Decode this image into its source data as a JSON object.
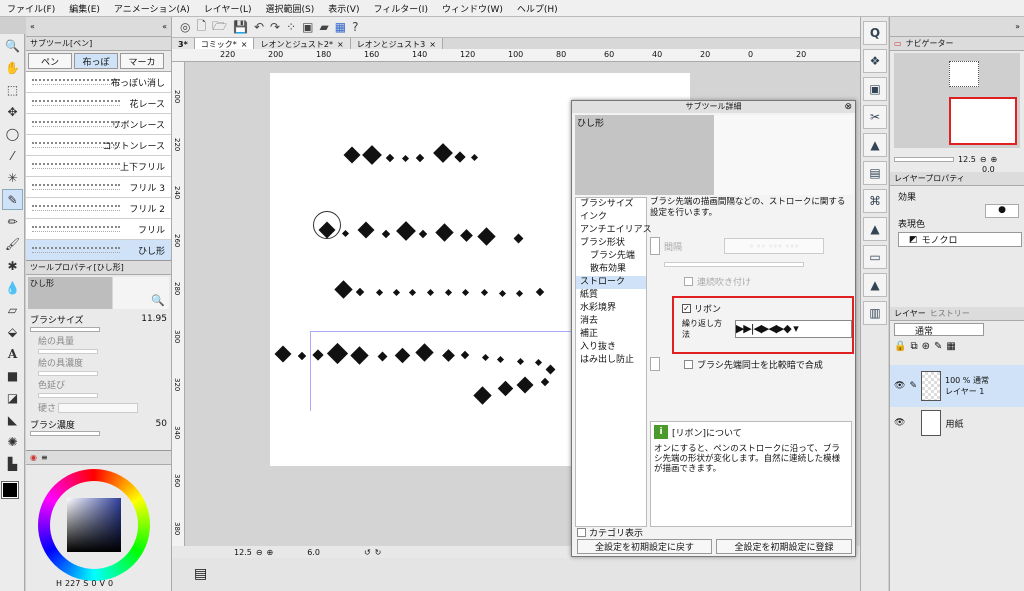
{
  "menu": [
    "ファイル(F)",
    "編集(E)",
    "アニメーション(A)",
    "レイヤー(L)",
    "選択範囲(S)",
    "表示(V)",
    "フィルター(I)",
    "ウィンドウ(W)",
    "ヘルプ(H)"
  ],
  "subtool": {
    "title": "サブツール[ペン]",
    "tabs": [
      "ペン",
      "布っぽ",
      "マーカ"
    ],
    "brushes": [
      "布っぽい消し",
      "花レース",
      "リボンレース",
      "コットンレース",
      "上下フリル",
      "フリル 3",
      "フリル 2",
      "フリル",
      "ひし形"
    ],
    "selected": "ひし形"
  },
  "toolprop": {
    "title": "ツールプロパティ[ひし形]",
    "preview_label": "ひし形",
    "brush_size_label": "ブラシサイズ",
    "brush_size": "11.95",
    "paint_amount": "絵の具量",
    "paint_density": "絵の具濃度",
    "color_stretch": "色延び",
    "hardness": "硬さ",
    "brush_density_label": "ブラシ濃度",
    "brush_density": "50"
  },
  "color": {
    "h": "227",
    "s": "0",
    "v": "0"
  },
  "doc_tabs": [
    "3*",
    "コミック*",
    "レオンとジュスト2*",
    "レオンとジュスト3"
  ],
  "ruler_h": [
    "220",
    "200",
    "180",
    "160",
    "140",
    "120",
    "100",
    "80",
    "60",
    "40",
    "20",
    "0",
    "20"
  ],
  "ruler_v": [
    "200",
    "220",
    "240",
    "260",
    "280",
    "300",
    "320",
    "340",
    "360",
    "380"
  ],
  "status": {
    "zoom": "12.5",
    "angle": "6.0"
  },
  "dialog": {
    "title": "サブツール詳細",
    "preview_label": "ひし形",
    "categories": [
      "ブラシサイズ",
      "インク",
      "アンチエイリアス",
      "ブラシ形状",
      "ブラシ先端",
      "散布効果",
      "ストローク",
      "紙質",
      "水彩境界",
      "消去",
      "補正",
      "入り抜き",
      "はみ出し防止"
    ],
    "indented": [
      4,
      5
    ],
    "selected": "ストローク",
    "description": "ブラシ先端の描画間隔などの、ストロークに関する設定を行います。",
    "spacing_label": "間隔",
    "continuous_label": "連続吹き付け",
    "ribbon_label": "リボン",
    "repeat_label": "繰り返し方法",
    "composite_label": "ブラシ先端同士を比較暗で合成",
    "help_title": "[リボン]について",
    "help_text": "オンにすると、ペンのストロークに沿って、ブラシ先端の形状が変化します。自然に連続した模様が描画できます。",
    "category_toggle": "カテゴリ表示",
    "reset_button": "全設定を初期設定に戻す",
    "register_button": "全設定を初期設定に登録"
  },
  "navigator": {
    "title": "ナビゲーター",
    "zoom": "12.5",
    "angle": "0.0"
  },
  "layerprop": {
    "title": "レイヤープロパティ",
    "effect": "効果",
    "display_color": "表現色",
    "mode": "モノクロ"
  },
  "layers": {
    "tabs": [
      "レイヤー",
      "ヒストリー"
    ],
    "blend": "通常",
    "items": [
      {
        "name": "100 % 通常",
        "sub": "レイヤー 1"
      },
      {
        "name": "用紙",
        "sub": ""
      }
    ]
  },
  "colors": {
    "accent": "#cfe2f7",
    "highlight": "#e02020"
  }
}
